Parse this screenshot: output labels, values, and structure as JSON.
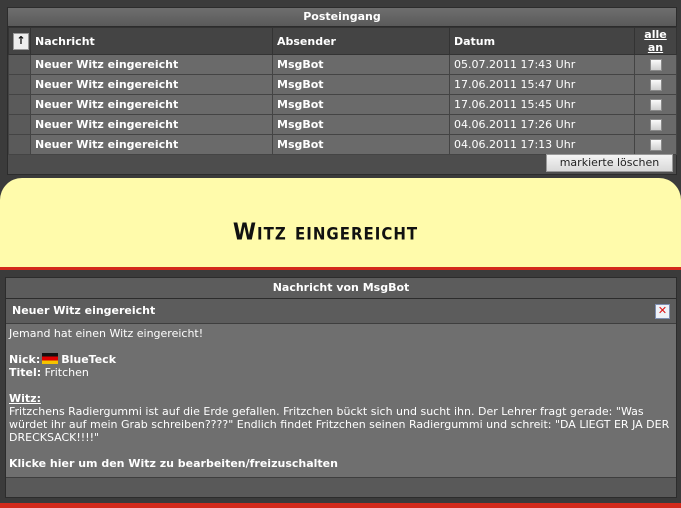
{
  "inbox": {
    "title": "Posteingang",
    "columns": {
      "sort_icon": "sort-arrow-icon",
      "subject": "Nachricht",
      "sender": "Absender",
      "date": "Datum",
      "select_all": "alle an"
    },
    "rows": [
      {
        "subject": "Neuer Witz eingereicht",
        "sender": "MsgBot",
        "date": "05.07.2011 17:43 Uhr"
      },
      {
        "subject": "Neuer Witz eingereicht",
        "sender": "MsgBot",
        "date": "17.06.2011 15:47 Uhr"
      },
      {
        "subject": "Neuer Witz eingereicht",
        "sender": "MsgBot",
        "date": "17.06.2011 15:45 Uhr"
      },
      {
        "subject": "Neuer Witz eingereicht",
        "sender": "MsgBot",
        "date": "04.06.2011 17:26 Uhr"
      },
      {
        "subject": "Neuer Witz eingereicht",
        "sender": "MsgBot",
        "date": "04.06.2011 17:13 Uhr"
      }
    ],
    "delete_button": "markierte löschen"
  },
  "banner": {
    "text": "Witz eingereicht",
    "color": "#fffbab",
    "accent": "#d32a1c"
  },
  "message": {
    "title": "Nachricht von MsgBot",
    "subject": "Neuer Witz eingereicht",
    "intro": "Jemand hat einen Witz eingereicht!",
    "nick_label": "Nick:",
    "nick_value": "BlueTeck",
    "nick_flag": "germany-flag-icon",
    "title_label": "Titel:",
    "title_value": "Fritchen",
    "joke_label": "Witz:",
    "joke_text": "Fritzchens Radiergummi ist auf die Erde gefallen. Fritzchen bückt sich und sucht ihn. Der Lehrer fragt gerade: \"Was würdet ihr auf mein Grab schreiben????\" Endlich findet Fritzchen seinen Radiergummi und schreit: \"DA LIEGT ER JA DER DRECKSACK!!!!\"",
    "edit_link": "Klicke hier um den Witz zu bearbeiten/freizuschalten"
  }
}
